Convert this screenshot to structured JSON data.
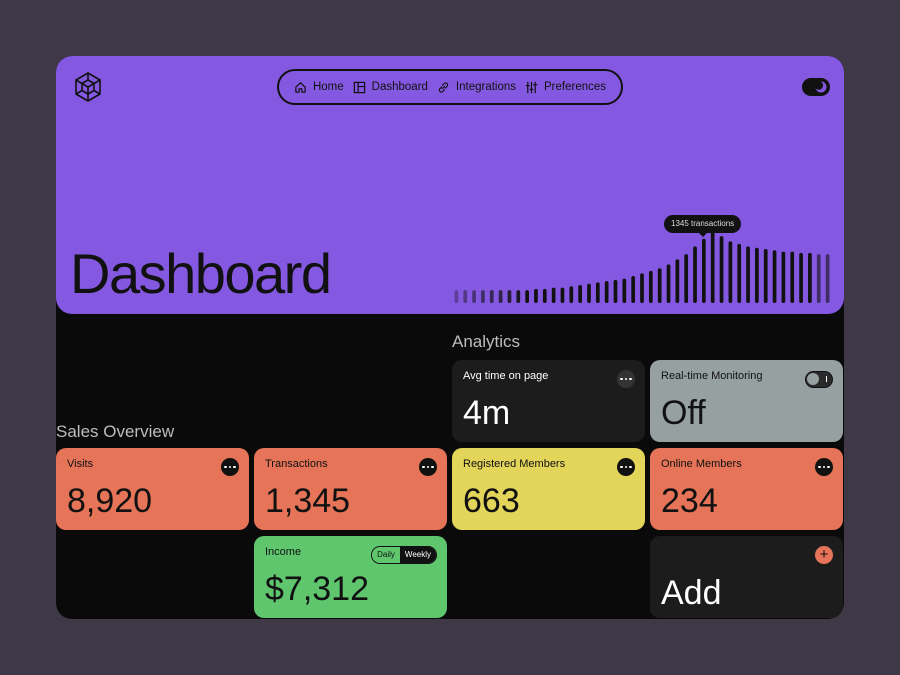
{
  "nav": {
    "items": [
      {
        "label": "Home",
        "icon": "home-icon"
      },
      {
        "label": "Dashboard",
        "icon": "dashboard-icon"
      },
      {
        "label": "Integrations",
        "icon": "link-icon"
      },
      {
        "label": "Preferences",
        "icon": "sliders-icon"
      }
    ]
  },
  "hero": {
    "title": "Dashboard",
    "tooltip": "1345 transactions"
  },
  "chart_data": {
    "type": "bar",
    "values": [
      10,
      10,
      10,
      10,
      10,
      10,
      10,
      10,
      10,
      11,
      11,
      12,
      12,
      13,
      14,
      15,
      16,
      17,
      18,
      19,
      21,
      23,
      25,
      27,
      30,
      34,
      38,
      44,
      50,
      56,
      52,
      48,
      46,
      44,
      43,
      42,
      41,
      40,
      40,
      39,
      39,
      38,
      38
    ],
    "highlight_index": 29,
    "colors": {
      "bar": "#111111",
      "highlight": "#111111"
    }
  },
  "analytics": {
    "label": "Analytics",
    "avg_time": {
      "title": "Avg time on page",
      "value": "4m"
    },
    "realtime": {
      "title": "Real-time Monitoring",
      "value": "Off"
    },
    "registered": {
      "title": "Registered Members",
      "value": "663"
    },
    "online": {
      "title": "Online Members",
      "value": "234"
    },
    "add": {
      "title": "Add"
    }
  },
  "sales": {
    "label": "Sales Overview",
    "visits": {
      "title": "Visits",
      "value": "8,920"
    },
    "transactions": {
      "title": "Transactions",
      "value": "1,345"
    },
    "income": {
      "title": "Income",
      "value": "$7,312",
      "toggle": {
        "daily": "Daily",
        "weekly": "Weekly"
      }
    }
  },
  "colors": {
    "hero": "#8458e0",
    "orange": "#e67458",
    "yellow": "#e3d45a",
    "grey": "#96a0a1",
    "green": "#5fc66e",
    "background": "#3f3846"
  }
}
